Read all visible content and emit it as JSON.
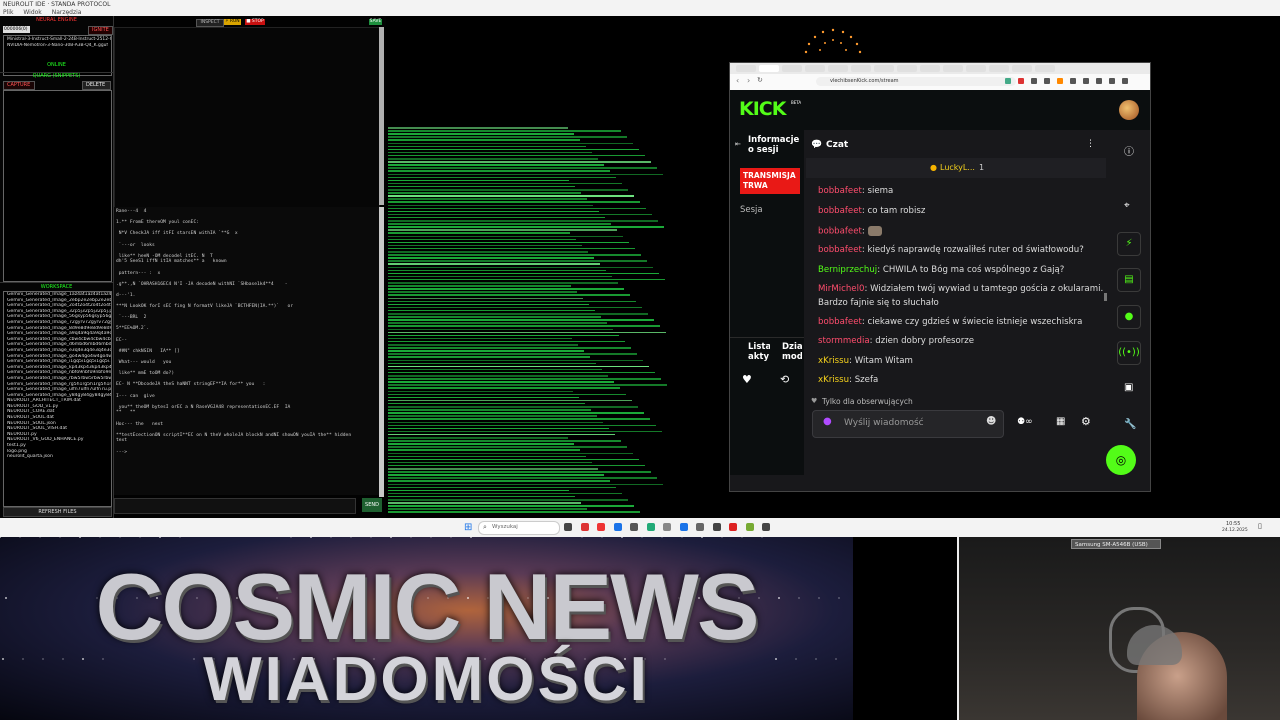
{
  "app": {
    "title": "NEUROLIT IDE · STANDA PROTOCOL",
    "menu": [
      "Plik",
      "Widok",
      "Narzędzia"
    ]
  },
  "left_panel": {
    "neural_engine_title": "NEURAL ENGINE",
    "id_field": "000006(0)",
    "ignite_button": "IGNITE",
    "models": [
      "Ministral-3-Instruct-Small-2-24B-Instruct-2512-Q4_K.gguf",
      "NVIDIA-Nemotron-3-Nano-30B-A3B-Q4_K.gguf"
    ],
    "online_label": "ONLINE",
    "quarg_title": "QUARG (SNIPPETS)",
    "capture_button": "CAPTURE",
    "delete_button": "DELETE",
    "workspace_title": "WORKSPACE",
    "files": [
      "Gemini_Generated_Image_1az4at1az4at1az4.png",
      "Gemini_Generated_Image_2ebp2e2ebp2e2ebp.png",
      "Gemini_Generated_Image_2o4t2o4t2o4t2o4t.png",
      "Gemini_Generated_Image_32p5j32p5j32p5j.png",
      "Gemini_Generated_Image_56gsyp56gsyp56gs.png",
      "Gemini_Generated_Image_72gyrv72gyrv72gy.png",
      "Gemini_Generated_Image_8d9e8d9e8d9e8d9e.png",
      "Gemini_Generated_Image_a9q4a9q4a9q4a9q4.png",
      "Gemini_Generated_Image_cbw4cbw4cbw4cbw4.png",
      "Gemini_Generated_Image_d6mbd6mbd6mbd6mb.png",
      "Gemini_Generated_Image_e3q4e3q4e3q4e3q4.png",
      "Gemini_Generated_Image_go4w4go4w4go4w4.png",
      "Gemini_Generated_Image_i1gq5i1gq5i1gq5i.png",
      "Gemini_Generated_Image_kp43kp43kp43kp43.png",
      "Gemini_Generated_Image_nbfo9nbfo9nbfo9n.png",
      "Gemini_Generated_Image_rbw5rbw5rbw5rbw5.png",
      "Gemini_Generated_Image_rg5h1rg5h1rg5h1r.png",
      "Gemini_Generated_Image_ulfn7ulfn7ulfn7u.png",
      "Gemini_Generated_Image_y84gy84gy84gy84g.png",
      "NEUROLIT_ARCHITECT_TRIM.dat",
      "NEUROLIT_GOD_v1.py",
      "NEUROLIT_CORE.dat",
      "NEUROLIT_SOUL.dat",
      "NEUROLIT_SOUL.json",
      "NEUROLIT_SOUL_VISH.dat",
      "NEUROLIT.py",
      "NEUROLIT_V6_GOD_ENHANCE.py",
      "test1.py",
      "logo.png",
      "neurolit_quarta.json"
    ],
    "refresh_button": "REFRESH FILES"
  },
  "console": {
    "toolbar": [
      "INSPECT",
      "⚡ RUN",
      "■ STOP"
    ],
    "save_button": "SAVE",
    "send_button": "SEND",
    "lines": [
      "Rane---4  4",
      "",
      "1.** FromE thereOM youl conEC:",
      "",
      " N*V CheckJA iff itFI starsEN withIA `**G  x",
      "",
      " `---or  looks",
      "",
      " like** heeN -OM decodel itEC. N  T",
      "dh'5 SeeS1 iffN itIA matches** a   known",
      "",
      " pattern--- :  x",
      "",
      ".g**.,N `OHRASH16EC4 N'I -JA decodeN withNI `SHbase1k4**4    -",
      "",
      "d---'1.",
      "",
      "***N LookOK forI sEC fing N formatV likeJA `BCTHFEN(IA.**)`   or",
      "",
      " `---BRL  2",
      "",
      "5**EE%OM.2`.",
      "",
      "EC--",
      "",
      " ##N\" chkNSIN   IA** []",
      "",
      " What--- would   you",
      "",
      " like** mmE toOM do?)",
      "",
      "EC- N **DbcodeJA theS haNNT stringEF**IA for** you   :",
      "",
      "I--- can  give",
      "",
      " you** theOM bytesI orEC a N RaseVGJA48 representationEC.EF  IA",
      "**   **",
      "",
      "Hoc--- the   next",
      "",
      "**testEcectionON scriptI**EC on N theV wholeJA blockN andNI showON youIA the** hidden",
      "text",
      "",
      "--->"
    ]
  },
  "browser": {
    "url": "vlechibsenKick.com/stream",
    "kick_logo": "KICK",
    "kick_beta": "BETA",
    "session_info": "Informacje o sesji",
    "live_button": "TRANSMISJA TRWA",
    "session_label": "Sesja",
    "list_label": "Lista akty",
    "activity_label": "Dzia mod",
    "chat_title": "Czat",
    "pinned_user": "LuckyL...",
    "pinned_count": "1",
    "messages": [
      {
        "user": "bobbafeet",
        "text": "siema",
        "color": "#ff4d6d"
      },
      {
        "user": "bobbafeet",
        "text": "co tam robisz",
        "color": "#ff4d6d"
      },
      {
        "user": "bobbafeet",
        "text": "",
        "color": "#ff4d6d"
      },
      {
        "user": "bobbafeet",
        "text": "kiedyś naprawdę rozwaliłeś ruter od światłowodu?",
        "color": "#ff4d6d"
      },
      {
        "user": "Berniprzechuj",
        "text": "CHWILA to Bóg ma coś wspólnego z Gają?",
        "color": "#53fc18"
      },
      {
        "user": "MirMichel0",
        "text": "Widziałem twój wywiad u tamtego gościa z okularami.",
        "color": "#ff4d6d"
      },
      {
        "user": "",
        "text": "Bardzo fajnie się to słuchało",
        "color": "#ddd"
      },
      {
        "user": "bobbafeet",
        "text": "ciekawe czy gdzieś w świecie istnieje wszechiskra",
        "color": "#ff4d6d"
      },
      {
        "user": "stormmedia",
        "text": "dzien dobry profesorze",
        "color": "#ff4d6d"
      },
      {
        "user": "xKrissu",
        "text": "Witam Witam",
        "color": "#f5d11c"
      },
      {
        "user": "xKrissu",
        "text": "Szefa",
        "color": "#f5d11c"
      }
    ],
    "followers_only": "Tylko dla obserwujących",
    "chat_placeholder": "Wyślij wiadomość"
  },
  "taskbar": {
    "search_placeholder": "Wyszukaj",
    "time": "10:55",
    "date": "24.12.2025"
  },
  "banner": {
    "line1": "COSMIC NEWS",
    "line2": "WIADOMOŚCI"
  },
  "webcam": {
    "device_label": "Samsung SM-A546B (USB)"
  },
  "colors": {
    "kick_green": "#53fc18",
    "live_red": "#e91916",
    "terminal_green": "#25d94a"
  }
}
